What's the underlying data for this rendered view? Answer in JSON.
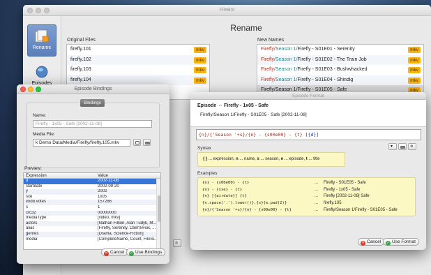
{
  "main": {
    "window_title": "FileBot",
    "heading": "Rename",
    "sidebar": [
      {
        "label": "Rename",
        "icon": "rename-icon"
      },
      {
        "label": "Episodes",
        "icon": "episodes-icon"
      }
    ],
    "original_files_label": "Original Files",
    "new_names_label": "New Names",
    "original_files": [
      {
        "name": "firefly.101",
        "ext": "mkv"
      },
      {
        "name": "firefly.102",
        "ext": "mkv"
      },
      {
        "name": "firefly.103",
        "ext": "mkv"
      },
      {
        "name": "firefly.104",
        "ext": "mkv"
      }
    ],
    "new_names": [
      {
        "path": "Firefly/",
        "season": "Season 1/",
        "rest": "Firefly - S01E01 - Serenity",
        "ext": "mkv"
      },
      {
        "path": "Firefly/",
        "season": "Season 1/",
        "rest": "Firefly - S01E02 - The Train Job",
        "ext": "mkv"
      },
      {
        "path": "Firefly/",
        "season": "Season 1/",
        "rest": "Firefly - S01E03 - Bushwhacked",
        "ext": "mkv"
      },
      {
        "path": "Firefly/",
        "season": "Season 1/",
        "rest": "Firefly - S01E04 - Shindig",
        "ext": "mkv"
      },
      {
        "path": "Firefly/",
        "season": "Season 1/",
        "rest": "Firefly - S01E05 - Safe",
        "ext": "mkv"
      }
    ]
  },
  "bindings": {
    "title": "Episode Bindings",
    "group_label": "Bindings",
    "name_label": "Name:",
    "name_value": "Firefly - 1x05 - Safe [2002-11-08]",
    "media_file_label": "Media File:",
    "media_file_value": "k Demo Data/Media/Firefly/firefly.105.mkv",
    "preview_label": "Preview:",
    "col_expression": "Expression",
    "col_value": "Value",
    "rows": [
      {
        "expr": "d",
        "value": "2002-11-08"
      },
      {
        "expr": "startdate",
        "value": "2002-09-20"
      },
      {
        "expr": "y",
        "value": "2002"
      },
      {
        "expr": "sxe",
        "value": "1x05"
      },
      {
        "expr": "imdb.votes",
        "value": "157286"
      },
      {
        "expr": "s",
        "value": "1"
      },
      {
        "expr": "crc32",
        "value": "00000000"
      },
      {
        "expr": "mediaType",
        "value": "[video, mkv]"
      },
      {
        "expr": "actors",
        "value": "[Nathan Fillion, Alan Tudyk, M..."
      },
      {
        "expr": "alias",
        "value": "[Firefly, Serenity, Светлячок, ..."
      },
      {
        "expr": "genres",
        "value": "[Drama, Science-Fiction]"
      },
      {
        "expr": "media",
        "value": "[CompleteName, Count, FileSi..."
      }
    ],
    "cancel_label": "Cancel",
    "use_label": "Use Bindings"
  },
  "format": {
    "title": "Episode Format",
    "episode_prefix": "Episode",
    "episode_arrow": "⇔",
    "episode_value": "Firefly - 1x05 - Safe",
    "episode_path": "Firefly/Season 1/Firefly - S01E05 - Safe [2002-11-08]",
    "expression_parts": [
      {
        "text": "{n}",
        "kind": "br"
      },
      {
        "text": "/{'Season '+s}/",
        "kind": "str"
      },
      {
        "text": "{n}",
        "kind": "br"
      },
      {
        "text": " - ",
        "kind": "plain"
      },
      {
        "text": "{s00e00}",
        "kind": "br"
      },
      {
        "text": " - ",
        "kind": "plain"
      },
      {
        "text": "{t}",
        "kind": "br"
      },
      {
        "text": " [{d}]",
        "kind": "mix"
      }
    ],
    "syntax_label": "Syntax",
    "syntax_parts": [
      {
        "text": "{ }",
        "bold": true
      },
      {
        "text": " ... expression, ",
        "bold": false
      },
      {
        "text": "n",
        "bold": true
      },
      {
        "text": " ... name, ",
        "bold": false
      },
      {
        "text": "s",
        "bold": true
      },
      {
        "text": " ... season, ",
        "bold": false
      },
      {
        "text": "e",
        "bold": true
      },
      {
        "text": " ... episode, ",
        "bold": false
      },
      {
        "text": "t",
        "bold": true
      },
      {
        "text": " ... title",
        "bold": false
      }
    ],
    "examples_label": "Examples",
    "examples": [
      {
        "expr": "{n} - {s00e00} - {t}",
        "dots": "...",
        "result": "Firefly - S01E05 - Safe"
      },
      {
        "expr": "{n} - {sxe} - {t}",
        "dots": "...",
        "result": "Firefly - 1x05 - Safe"
      },
      {
        "expr": "{n} [{airdate}] {t}",
        "dots": "...",
        "result": "Firefly [2002-11-08] Safe"
      },
      {
        "expr": "{n.space('.').lower()}.{s}{e.pad(2)}",
        "dots": "...",
        "result": "firefly.105"
      },
      {
        "expr": "{n}/{'Season '+s}/{n} - {s00e00} - {t}",
        "dots": "...",
        "result": "Firefly/Season 1/Firefly - S01E05 - Safe"
      }
    ],
    "cancel_label": "Cancel",
    "use_label": "Use Format"
  },
  "colors": {
    "badge": "#f9b30f",
    "path": "#b2361f",
    "season": "#2a8a86",
    "selection": "#3875d7",
    "note_bg": "#fcf8c3"
  }
}
